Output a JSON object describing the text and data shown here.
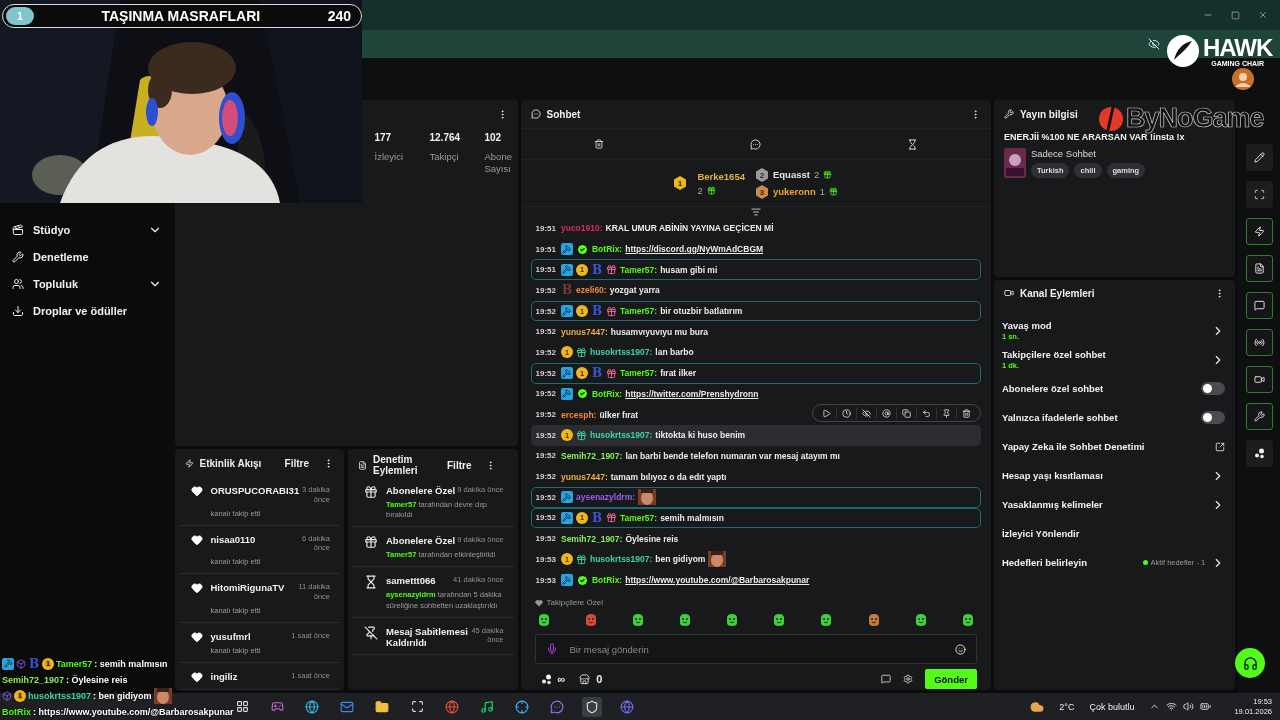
{
  "overlay_banner": {
    "rank": "1",
    "title": "TAŞINMA MASRAFLARI",
    "amount": "240"
  },
  "logos": {
    "hawk": "HAWK",
    "hawk_sub": "GAMING CHAIR",
    "bynogame": "ByNoGame"
  },
  "sidebar": {
    "items": [
      {
        "kind": "studio",
        "label": "Stüdyo",
        "expandable": true
      },
      {
        "kind": "moderation",
        "label": "Denetleme",
        "expandable": false
      },
      {
        "kind": "community",
        "label": "Topluluk",
        "expandable": true
      },
      {
        "kind": "drops",
        "label": "Droplar ve ödüller",
        "expandable": false
      }
    ]
  },
  "stats": [
    {
      "value": "177",
      "label": "İzleyici"
    },
    {
      "value": "12.764",
      "label": "Takipçi"
    },
    {
      "value": "102",
      "label": "Abone Sayısı"
    }
  ],
  "activity_feed": {
    "title": "Etkinlik Akışı",
    "filter": "Filtre",
    "items": [
      {
        "user": "ORUSPUCORABI31",
        "time": "3 dakika önce",
        "action": "kanalı takip etti"
      },
      {
        "user": "nisaa0110",
        "time": "6 dakika önce",
        "action": "kanalı takip etti"
      },
      {
        "user": "HitomiRigunaTV",
        "time": "11 dakika önce",
        "action": "kanalı takip etti"
      },
      {
        "user": "yusufmrl",
        "time": "1 saat önce",
        "action": "kanalı takip etti"
      },
      {
        "user": "ingiliz",
        "time": "1 saat önce"
      }
    ]
  },
  "mod_log": {
    "title": "Denetim Eylemleri",
    "filter": "Filtre",
    "items": [
      {
        "kind": "gift",
        "title": "Abonelere Özel",
        "time": "9 dakika önce",
        "actor": "Tamer57",
        "text": " tarafından devre dışı bırakıldı"
      },
      {
        "kind": "gift",
        "title": "Abonelere Özel",
        "time": "9 dakika önce",
        "actor": "Tamer57",
        "text": " tarafından etkinleştirildi"
      },
      {
        "kind": "timeout",
        "title": "samettt066",
        "time": "41 dakika önce",
        "actor": "aysenazyldrm",
        "text": " tarafından 5 dakika süreliğine sohbetten uzaklaştırıldı"
      },
      {
        "kind": "unpin",
        "title": "Mesaj Sabitlemesi Kaldırıldı",
        "time": "45 dakika önce"
      }
    ]
  },
  "chat": {
    "title": "Sohbet",
    "leaderboard": [
      {
        "rank": "1",
        "name": "Berke1654",
        "count": "2",
        "color": "#e3b341"
      },
      {
        "rank": "2",
        "name": "Equasst",
        "count": "2",
        "color": "#e6e6e6"
      },
      {
        "rank": "3",
        "name": "yukeronn",
        "count": "1",
        "color": "#f0a43a"
      }
    ],
    "messages": [
      {
        "time": "19:51",
        "user": "yuco1910:",
        "color": "#e0245e",
        "kind": "text",
        "body": "KRAL UMUR ABİNİN YAYINA GEÇİCEN Mİ",
        "highlighted": false,
        "hovered": false
      },
      {
        "time": "19:51",
        "badges": [
          {
            "kind": "mod"
          },
          {
            "kind": "verified"
          }
        ],
        "user": "BotRix:",
        "color": "#53fc18",
        "kind": "link",
        "body": "https://discord.gg/NyWmAdCBGM",
        "highlighted": false,
        "hovered": false
      },
      {
        "time": "19:51",
        "badges": [
          {
            "kind": "mod"
          },
          {
            "kind": "coin",
            "label": "1"
          },
          {
            "kind": "letter",
            "label": "B"
          },
          {
            "kind": "gift"
          }
        ],
        "user": "Tamer57:",
        "color": "#53fc18",
        "kind": "text",
        "body": "husam gibi mi",
        "highlighted": true,
        "hovered": false
      },
      {
        "time": "19:52",
        "badges": [
          {
            "kind": "letter-dark",
            "label": "B"
          }
        ],
        "user": "ezeli60:",
        "color": "#f08a3a",
        "kind": "text",
        "body": "yozgat yarra",
        "highlighted": false,
        "hovered": false
      },
      {
        "time": "19:52",
        "badges": [
          {
            "kind": "mod"
          },
          {
            "kind": "coin",
            "label": "1"
          },
          {
            "kind": "letter",
            "label": "B"
          },
          {
            "kind": "gift"
          }
        ],
        "user": "Tamer57:",
        "color": "#53fc18",
        "kind": "text",
        "body": "bir otuzbir batlatırım",
        "highlighted": true,
        "hovered": false
      },
      {
        "time": "19:52",
        "user": "yunus7447:",
        "color": "#e8b04a",
        "kind": "text",
        "body": "husamvıyuvıyu mu bura",
        "highlighted": false,
        "hovered": false
      },
      {
        "time": "19:52",
        "badges": [
          {
            "kind": "coin",
            "label": "1"
          },
          {
            "kind": "sub"
          }
        ],
        "user": "husokrtss1907:",
        "color": "#3ed6a0",
        "kind": "text",
        "body": "lan barbo",
        "highlighted": false,
        "hovered": false
      },
      {
        "time": "19:52",
        "badges": [
          {
            "kind": "mod"
          },
          {
            "kind": "coin",
            "label": "1"
          },
          {
            "kind": "letter",
            "label": "B"
          },
          {
            "kind": "gift"
          }
        ],
        "user": "Tamer57:",
        "color": "#53fc18",
        "kind": "text",
        "body": "fırat ilker",
        "highlighted": true,
        "hovered": false
      },
      {
        "time": "19:52",
        "badges": [
          {
            "kind": "mod"
          },
          {
            "kind": "verified"
          }
        ],
        "user": "BotRix:",
        "color": "#53fc18",
        "kind": "link",
        "body": "https://twitter.com/Prenshydronn",
        "highlighted": false,
        "hovered": false
      },
      {
        "time": "19:52",
        "user": "ercesph:",
        "color": "#f08a3a",
        "kind": "text",
        "body": "ülker fırat",
        "highlighted": false,
        "hovered": false
      },
      {
        "time": "19:52",
        "badges": [
          {
            "kind": "coin",
            "label": "1"
          },
          {
            "kind": "sub"
          }
        ],
        "user": "husokrtss1907:",
        "color": "#3ed6a0",
        "kind": "text",
        "body": "tiktokta ki huso benim",
        "highlighted": false,
        "hovered": true
      },
      {
        "time": "19:52",
        "user": "Semih72_1907:",
        "color": "#8df05a",
        "kind": "text",
        "body": "lan barbi bende telefon numaran var mesaj atayım mı",
        "highlighted": false,
        "hovered": false
      },
      {
        "time": "19:52",
        "user": "yunus7447:",
        "color": "#e8b04a",
        "kind": "text",
        "body": "tamam bılıyoz o da edıt yaptı",
        "highlighted": false,
        "hovered": false
      },
      {
        "time": "19:52",
        "badges": [
          {
            "kind": "mod"
          }
        ],
        "user": "aysenazyldrm:",
        "color": "#9b5cf0",
        "kind": "emote",
        "highlighted": true,
        "hovered": false
      },
      {
        "time": "19:52",
        "badges": [
          {
            "kind": "mod"
          },
          {
            "kind": "coin",
            "label": "1"
          },
          {
            "kind": "letter",
            "label": "B"
          },
          {
            "kind": "gift"
          }
        ],
        "user": "Tamer57:",
        "color": "#53fc18",
        "kind": "text",
        "body": "semih malmısın",
        "highlighted": true,
        "hovered": false
      },
      {
        "time": "19:52",
        "user": "Semih72_1907:",
        "color": "#8df05a",
        "kind": "text",
        "body": "Öylesine reis",
        "highlighted": false,
        "hovered": false
      },
      {
        "time": "19:53",
        "badges": [
          {
            "kind": "coin",
            "label": "1"
          },
          {
            "kind": "sub"
          }
        ],
        "user": "husokrtss1907:",
        "color": "#3ed6a0",
        "kind": "text_emote",
        "body": "ben gidiyom",
        "highlighted": false,
        "hovered": false
      },
      {
        "time": "19:53",
        "badges": [
          {
            "kind": "mod"
          },
          {
            "kind": "verified"
          }
        ],
        "user": "BotRix:",
        "color": "#53fc18",
        "kind": "link",
        "body": "https://www.youtube.com/@Barbarosakpunar",
        "highlighted": false,
        "hovered": false
      }
    ],
    "emote_section": "Takipçilere Özel",
    "input": {
      "placeholder": "Bir mesaj gönderin"
    },
    "footer": {
      "infinity": "∞",
      "store_count": "0",
      "send": "Gönder"
    }
  },
  "stream_info": {
    "title": "Yayın bilgisi",
    "stream_title": "ENERJİİ %100 NE ARARSAN VAR !insta !x",
    "category": "Sadece Sohbet",
    "tags": [
      "Turkish",
      "chill",
      "gaming"
    ]
  },
  "channel_actions": {
    "title": "Kanal Eylemleri",
    "items": [
      {
        "kind": "nav",
        "label": "Yavaş mod",
        "value": "1 sn."
      },
      {
        "kind": "nav",
        "label": "Takipçilere özel sohbet",
        "value": "1 dk."
      },
      {
        "kind": "toggle",
        "label": "Abonelere özel sohbet",
        "on": false
      },
      {
        "kind": "toggle",
        "label": "Yalnızca ifadelerle sohbet",
        "on": false
      },
      {
        "kind": "external",
        "label": "Yapay Zeka ile Sohbet Denetimi"
      },
      {
        "kind": "nav",
        "label": "Hesap yaşı kısıtlaması"
      },
      {
        "kind": "nav",
        "label": "Yasaklanmış kelimeler"
      },
      {
        "kind": "plain",
        "label": "İzleyici Yönlendir"
      },
      {
        "kind": "nav",
        "label": "Hedefleri belirleyin",
        "status": "Aktif hedefler - 1"
      }
    ]
  },
  "rail": [
    {
      "kind": "pencil",
      "active": false
    },
    {
      "kind": "scan",
      "active": false
    },
    {
      "kind": "zap",
      "active": true
    },
    {
      "kind": "file",
      "active": true
    },
    {
      "kind": "chat",
      "active": true
    },
    {
      "kind": "radio",
      "active": true
    },
    {
      "kind": "video",
      "active": true
    },
    {
      "kind": "wrench",
      "active": true
    },
    {
      "kind": "dots",
      "active": false
    }
  ],
  "stream_overlay_chat": [
    {
      "badges": [
        {
          "kind": "mod"
        },
        {
          "kind": "cube"
        },
        {
          "kind": "letter",
          "label": "B"
        },
        {
          "kind": "coin",
          "label": "1"
        }
      ],
      "user": "Tamer57",
      "color": "#53fc18",
      "text": ": semih malmısın",
      "emote": false
    },
    {
      "user": "Semih72_1907",
      "color": "#8df05a",
      "text": ": Öylesine reis",
      "emote": false
    },
    {
      "badges": [
        {
          "kind": "cube"
        },
        {
          "kind": "coin",
          "label": "1"
        }
      ],
      "user": "husokrtss1907",
      "color": "#3ed6a0",
      "text": ": ben gidiyom",
      "emote": true
    },
    {
      "user": "BotRix",
      "color": "#53fc18",
      "text": ": https://www.youtube.com/@Barbarosakpunar",
      "emote": false
    }
  ],
  "taskbar": {
    "temperature": "2°C",
    "weather": "Çok bulutlu",
    "time": "19:53",
    "date": "19.01.2026"
  }
}
